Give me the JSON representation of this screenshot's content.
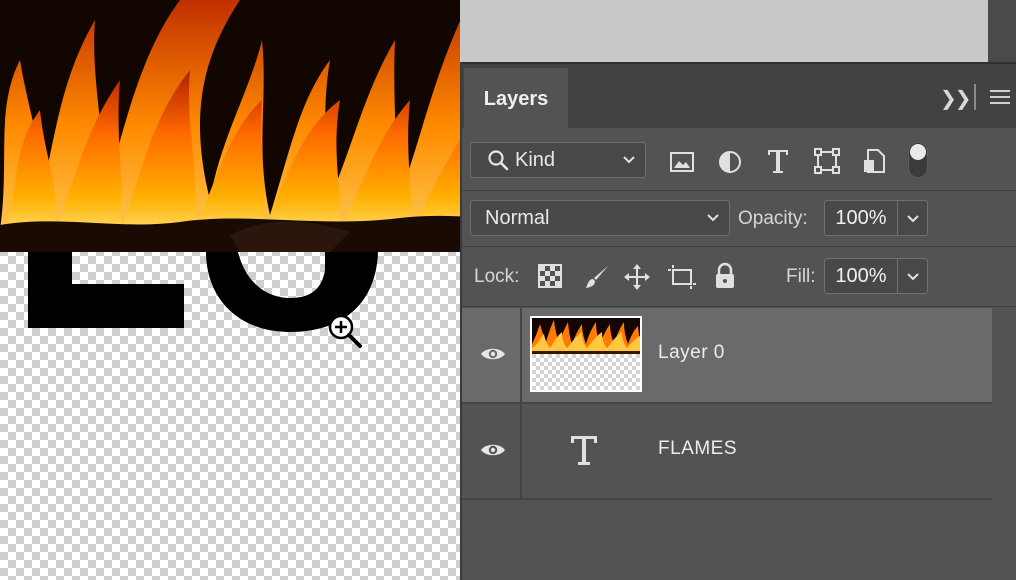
{
  "panel": {
    "tab_label": "Layers",
    "collapse_icon": "double-chevron-right-icon",
    "menu_icon": "panel-menu-icon"
  },
  "filter": {
    "kind_label": "Kind",
    "icons": [
      "search-icon",
      "image-filter-icon",
      "adjustment-filter-icon",
      "type-filter-icon",
      "shape-filter-icon",
      "smart-object-filter-icon",
      "filter-toggle"
    ]
  },
  "blend": {
    "mode": "Normal",
    "opacity_label": "Opacity:",
    "opacity_value": "100%"
  },
  "lock": {
    "label": "Lock:",
    "icons": [
      "lock-transparent-pixels-icon",
      "lock-image-pixels-icon",
      "lock-position-icon",
      "lock-artboard-icon",
      "lock-all-icon"
    ],
    "fill_label": "Fill:",
    "fill_value": "100%"
  },
  "layers": [
    {
      "name": "Layer 0",
      "selected": true,
      "visible": true,
      "thumbnail": "flames-thumbnail"
    },
    {
      "name": "FLAMES",
      "selected": false,
      "visible": true,
      "thumbnail": "type-layer-icon"
    }
  ],
  "colors": {
    "panel_bg": "#535353",
    "selected_row": "#6a6a6a",
    "header_bg": "#424242"
  }
}
